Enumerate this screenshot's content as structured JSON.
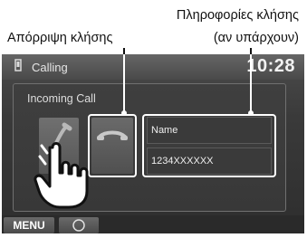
{
  "callouts": {
    "reject_call": "Απόρριψη κλήσης",
    "caller_info_line1": "Πληροφορίες κλήσης",
    "caller_info_line2": "(αν υπάρχουν)"
  },
  "status_bar": {
    "title": "Calling",
    "time": "10:28",
    "icon": "phone-signal-icon"
  },
  "panel": {
    "title": "Incoming Call",
    "answer_icon": "phone-answer-icon",
    "reject_icon": "phone-reject-icon"
  },
  "caller": {
    "name": "Name",
    "number": "1234XXXXXX"
  },
  "bottom_bar": {
    "menu_label": "MENU",
    "round_icon": "home-circle-icon"
  },
  "colors": {
    "screen_bg": "#3a3a3a",
    "highlight_frame": "#ffffff",
    "text": "#eeeeee"
  }
}
